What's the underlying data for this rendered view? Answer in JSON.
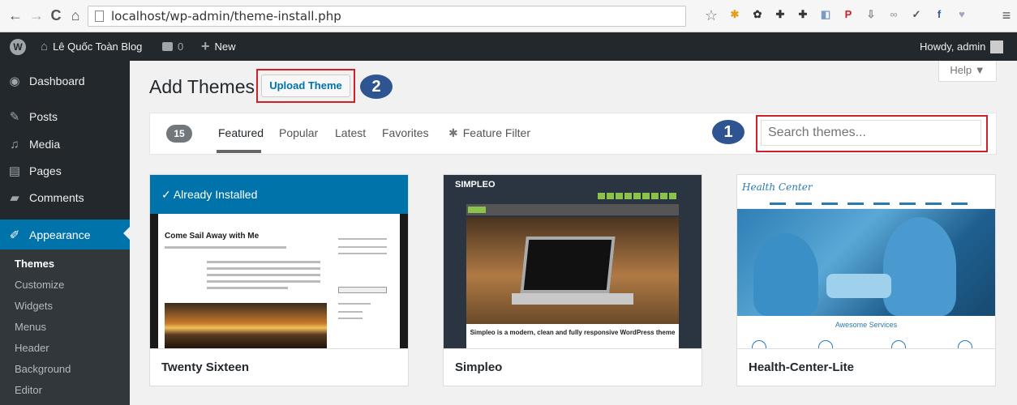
{
  "browser": {
    "url": "localhost/wp-admin/theme-install.php",
    "back_glyph": "←",
    "forward_glyph": "→",
    "reload_glyph": "C",
    "home_glyph": "⌂",
    "star_glyph": "☆",
    "extensions": [
      {
        "icon": "bug-icon",
        "glyph": "✱",
        "color": "#e0a020"
      },
      {
        "icon": "gear-icon",
        "glyph": "✿",
        "color": "#333333"
      },
      {
        "icon": "puzzle-icon",
        "glyph": "✚",
        "color": "#333333"
      },
      {
        "icon": "puzzle-icon",
        "glyph": "✚",
        "color": "#333333"
      },
      {
        "icon": "code-icon",
        "glyph": "◧",
        "color": "#7a9ac0"
      },
      {
        "icon": "pinterest-icon",
        "glyph": "P",
        "color": "#cb2027"
      },
      {
        "icon": "download-icon",
        "glyph": "⇩",
        "color": "#888888"
      },
      {
        "icon": "glasses-icon",
        "glyph": "∞",
        "color": "#aaaaaa"
      },
      {
        "icon": "check-icon",
        "glyph": "✓",
        "color": "#555555"
      },
      {
        "icon": "facebook-icon",
        "glyph": "f",
        "color": "#3b5998"
      },
      {
        "icon": "heart-icon",
        "glyph": "♥",
        "color": "#a0a8c0"
      }
    ],
    "menu_glyph": "≡"
  },
  "adminbar": {
    "site_name": "Lê Quốc Toàn Blog",
    "comments_count": "0",
    "new_label": "New",
    "howdy": "Howdy, admin"
  },
  "sidebar": {
    "items": [
      {
        "label": "Dashboard",
        "icon": "dashboard-icon",
        "glyph": "◉"
      },
      {
        "label": "Posts",
        "icon": "pin-icon",
        "glyph": "✎"
      },
      {
        "label": "Media",
        "icon": "media-icon",
        "glyph": "♫"
      },
      {
        "label": "Pages",
        "icon": "pages-icon",
        "glyph": "▤"
      },
      {
        "label": "Comments",
        "icon": "comment-icon",
        "glyph": "▰"
      },
      {
        "label": "Appearance",
        "icon": "brush-icon",
        "glyph": "✐"
      }
    ],
    "submenu": [
      "Themes",
      "Customize",
      "Widgets",
      "Menus",
      "Header",
      "Background",
      "Editor"
    ]
  },
  "help_label": "Help ▼",
  "page_title": "Add Themes",
  "upload_button": "Upload Theme",
  "annotations": {
    "step1": "1",
    "step2": "2"
  },
  "filter": {
    "count": "15",
    "tabs": [
      "Featured",
      "Popular",
      "Latest",
      "Favorites"
    ],
    "feature_filter": "Feature Filter",
    "search_placeholder": "Search themes..."
  },
  "themes": [
    {
      "name": "Twenty Sixteen",
      "installed_label": "✓  Already Installed",
      "preview_title": "Come Sail Away with Me"
    },
    {
      "name": "Simpleo",
      "preview_logo": "SIMPLEO",
      "preview_tagline": "Simpleo is a modern, clean and fully responsive WordPress theme"
    },
    {
      "name": "Health-Center-Lite",
      "preview_logo": "Health Center",
      "preview_services": "Awesome Services"
    }
  ],
  "colors": {
    "admin_dark": "#23282d",
    "accent_blue": "#0073aa",
    "highlight_red": "#d0202a",
    "badge_blue": "#2e5592"
  }
}
